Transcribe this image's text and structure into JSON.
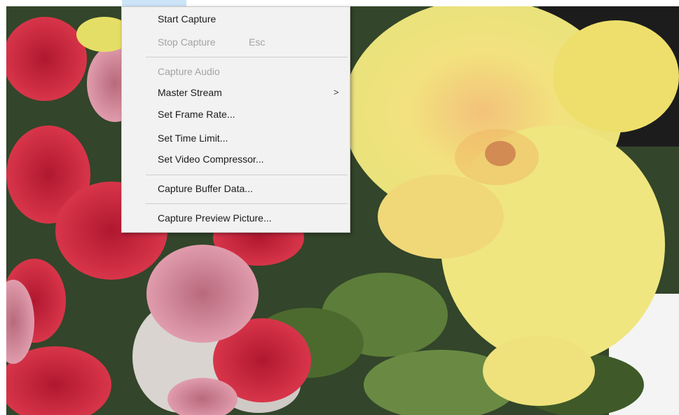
{
  "colors": {
    "menu_bg": "#f2f2f2",
    "disabled_text": "#a3a3a3",
    "highlight": "#cce4f7"
  },
  "menu": {
    "items": [
      {
        "label": "Start Capture",
        "enabled": true
      },
      {
        "label": "Stop Capture",
        "shortcut": "Esc",
        "enabled": false
      },
      {
        "label": "Capture Audio",
        "enabled": false
      },
      {
        "label": "Master Stream",
        "submenu_arrow": ">",
        "enabled": true
      },
      {
        "label": "Set Frame Rate...",
        "enabled": true
      },
      {
        "label": "Set Time Limit...",
        "enabled": true
      },
      {
        "label": "Set Video Compressor...",
        "enabled": true
      },
      {
        "label": "Capture Buffer Data...",
        "enabled": true
      },
      {
        "label": "Capture Preview Picture...",
        "enabled": true
      }
    ]
  }
}
